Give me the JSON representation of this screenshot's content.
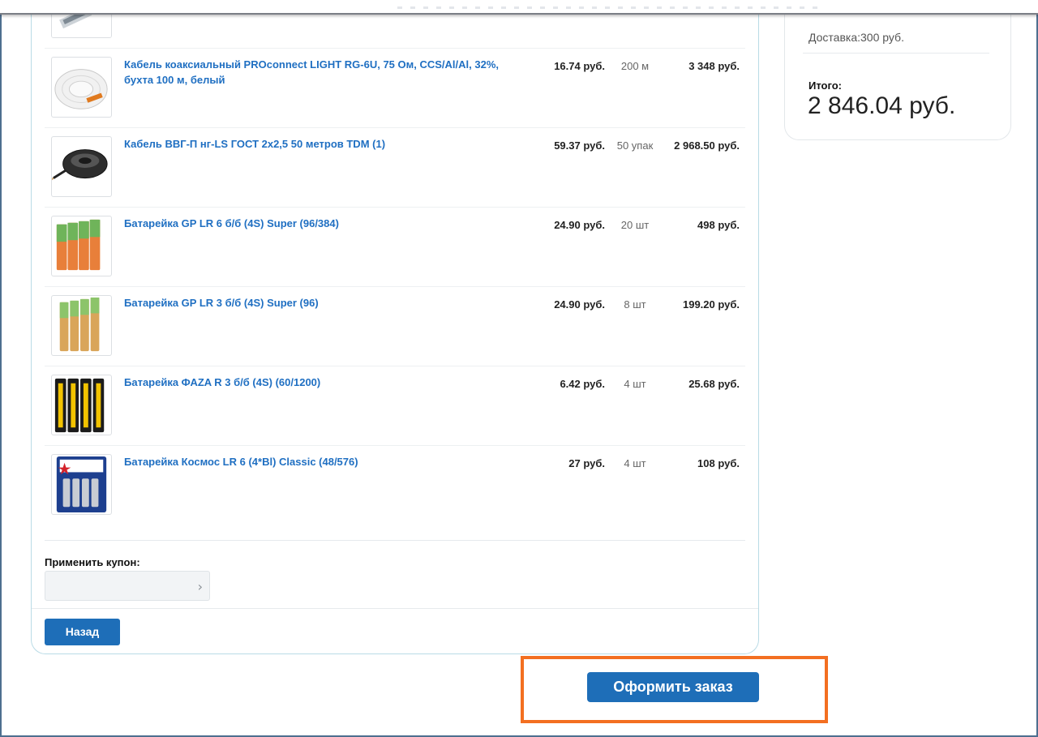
{
  "cart": {
    "items": [
      {
        "name": "",
        "price": "",
        "qty": "",
        "sum": "",
        "image_icon": "cable-spool-icon"
      },
      {
        "name": "Кабель коаксиальный PROconnect LIGHT RG-6U, 75 Ом, CCS/Al/Al, 32%, бухта 100 м, белый",
        "price": "16.74 руб.",
        "qty": "200 м",
        "sum": "3 348 руб.",
        "image_icon": "white-cable-coil-icon"
      },
      {
        "name": "Кабель ВВГ-П нг-LS ГОСТ 2х2,5 50 метров TDM (1)",
        "price": "59.37 руб.",
        "qty": "50 упак",
        "sum": "2 968.50 руб.",
        "image_icon": "black-cable-coil-icon"
      },
      {
        "name": "Батарейка GP LR 6 б/б (4S) Super (96/384)",
        "price": "24.90 руб.",
        "qty": "20 шт",
        "sum": "498 руб.",
        "image_icon": "battery-gp-aa-icon"
      },
      {
        "name": "Батарейка GP LR 3 б/б (4S) Super (96)",
        "price": "24.90 руб.",
        "qty": "8 шт",
        "sum": "199.20 руб.",
        "image_icon": "battery-gp-aaa-icon"
      },
      {
        "name": "Батарейка ФАZA R 3 б/б (4S) (60/1200)",
        "price": "6.42 руб.",
        "qty": "4 шт",
        "sum": "25.68 руб.",
        "image_icon": "battery-faza-icon"
      },
      {
        "name": "Батарейка Космос LR 6 (4*Bl) Classic (48/576)",
        "price": "27 руб.",
        "qty": "4 шт",
        "sum": "108 руб.",
        "image_icon": "battery-kosmos-icon"
      }
    ],
    "coupon_label": "Применить купон:",
    "coupon_value": "",
    "back_label": "Назад"
  },
  "summary": {
    "delivery": "Доставка:300 руб.",
    "total_label": "Итого:",
    "total_value": "2 846.04 руб."
  },
  "checkout_label": "Оформить заказ",
  "colors": {
    "accent": "#1e6eb8",
    "link": "#1f6fc2",
    "highlight": "#f36f21"
  }
}
